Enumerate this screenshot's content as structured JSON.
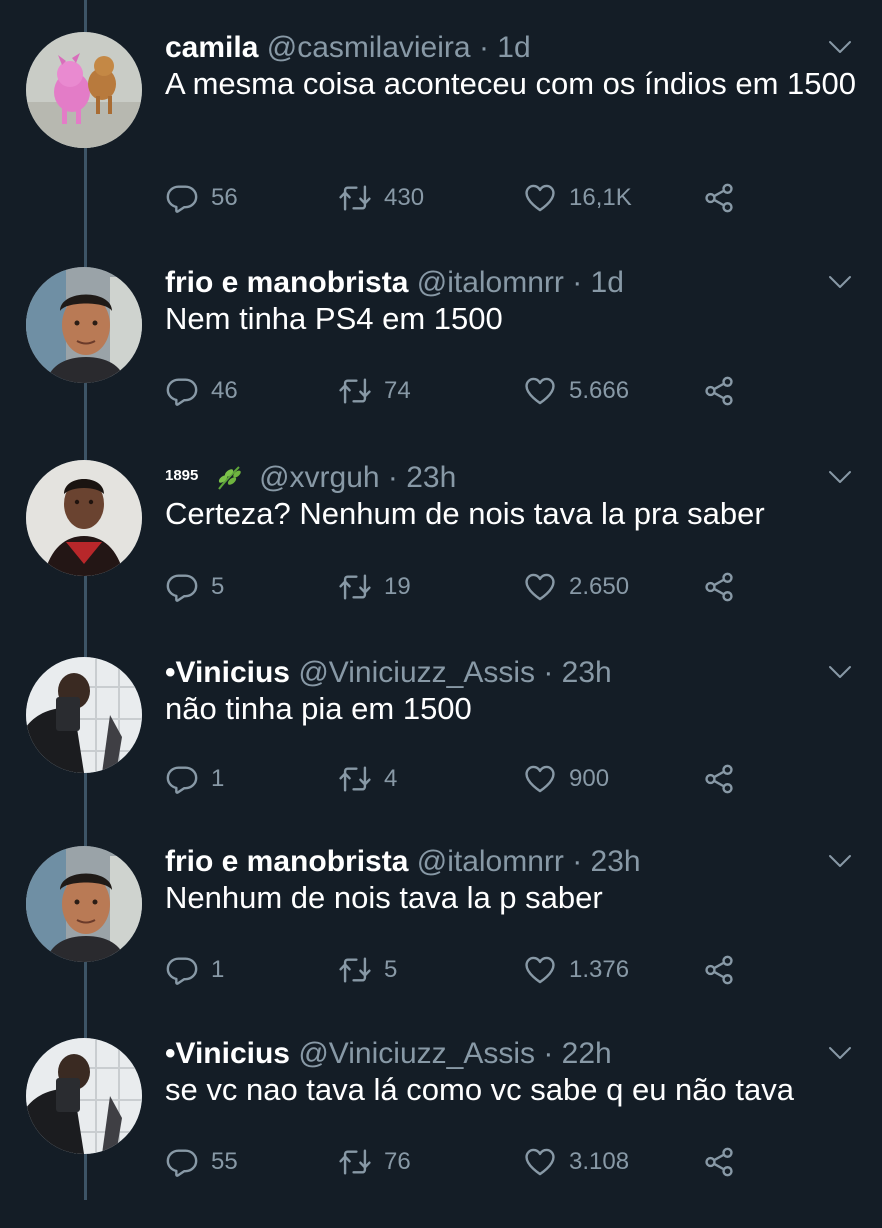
{
  "tweets": [
    {
      "name": "camila",
      "handle": "@casmilavieira",
      "time": "· 1d",
      "text": "A mesma coisa aconteceu com os índios em 1500",
      "replies": "56",
      "retweets": "430",
      "likes": "16,1K",
      "avatar": "pink-dog-avatar"
    },
    {
      "name": "frio e manobrista",
      "handle": "@italomnrr",
      "time": "· 1d",
      "text": "Nem tinha PS4 em 1500",
      "replies": "46",
      "retweets": "74",
      "likes": "5.666",
      "avatar": "man-selfie-avatar"
    },
    {
      "name": "1895",
      "name_emoji": "herb-emoji",
      "handle": "@xvrguh",
      "time": "· 23h",
      "text": "Certeza? Nenhum de nois tava la pra saber",
      "replies": "5",
      "retweets": "19",
      "likes": "2.650",
      "avatar": "man-avatar"
    },
    {
      "name": "•Vinicius",
      "handle": "@Viniciuzz_Assis",
      "time": "· 23h",
      "text": "não tinha pia em 1500",
      "replies": "1",
      "retweets": "4",
      "likes": "900",
      "avatar": "mirror-selfie-avatar"
    },
    {
      "name": "frio e manobrista",
      "handle": "@italomnrr",
      "time": "· 23h",
      "text": "Nenhum de nois tava la p saber",
      "replies": "1",
      "retweets": "5",
      "likes": "1.376",
      "avatar": "man-selfie-avatar"
    },
    {
      "name": "•Vinicius",
      "handle": "@Viniciuzz_Assis",
      "time": "· 22h",
      "text": "se vc nao tava lá como vc sabe q eu não tava",
      "replies": "55",
      "retweets": "76",
      "likes": "3.108",
      "avatar": "mirror-selfie-avatar"
    }
  ],
  "colors": {
    "background": "#141d26",
    "secondary_text": "#8899a6",
    "thread_line": "#3d5466"
  }
}
